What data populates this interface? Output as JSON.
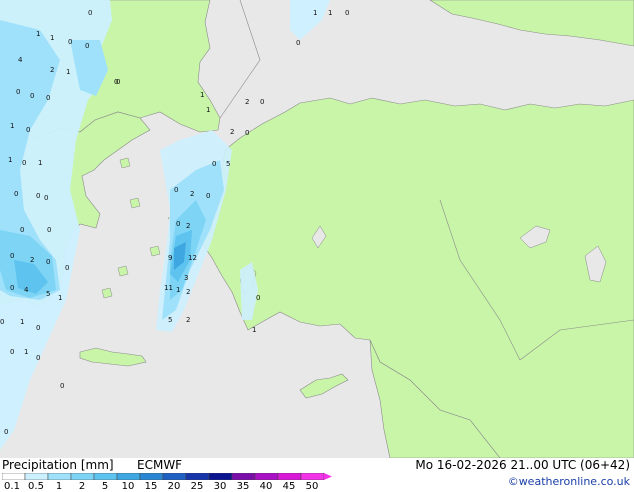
{
  "map": {
    "precip_values": [
      "1",
      "1",
      "0",
      "0",
      "4",
      "1",
      "1",
      "0",
      "0",
      "2",
      "1",
      "0",
      "0",
      "0",
      "0",
      "1",
      "0",
      "1",
      "0",
      "1",
      "0",
      "0",
      "0",
      "0",
      "2",
      "0",
      "0",
      "0",
      "2",
      "5",
      "0",
      "2",
      "0",
      "0",
      "2",
      "0",
      "0",
      "0",
      "2",
      "0",
      "12",
      "9",
      "3",
      "2",
      "2",
      "0",
      "4",
      "5",
      "1",
      "0",
      "1",
      "11",
      "1",
      "5",
      "0",
      "1",
      "0",
      "0",
      "1",
      "0",
      "0",
      "0",
      "0",
      "1",
      "1",
      "0"
    ],
    "colors": {
      "land": "#c8f5a8",
      "sea": "#e8e8e8",
      "border": "#8a8a8a"
    }
  },
  "legend": {
    "title": "Precipitation [mm]",
    "model": "ECMWF",
    "datetime": "Mo 16-02-2026 21..00 UTC (06+42)",
    "credit": "©weatheronline.co.uk",
    "ticks": [
      "0.1",
      "0.5",
      "1",
      "2",
      "5",
      "10",
      "15",
      "20",
      "25",
      "30",
      "35",
      "40",
      "45",
      "50"
    ],
    "colors": [
      "#ffffff",
      "#cdf0ff",
      "#9fe1fb",
      "#7dd4f5",
      "#5ec3ee",
      "#3ea7e2",
      "#2a86d3",
      "#1e5fc2",
      "#1535a8",
      "#0c1590",
      "#7a0ea8",
      "#a912c4",
      "#d81ad8",
      "#f233e8"
    ]
  }
}
